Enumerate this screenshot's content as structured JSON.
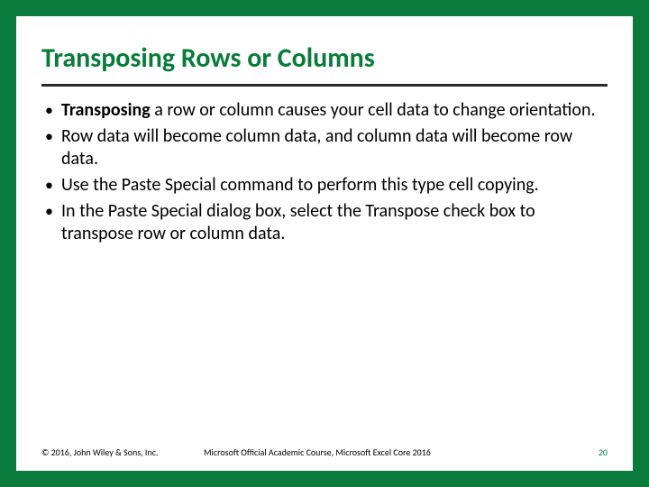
{
  "title": "Transposing Rows or Columns",
  "bullets": [
    {
      "strong": "Transposing",
      "rest": " a row or column causes your cell data to change orientation."
    },
    {
      "strong": "",
      "rest": "Row data will become column data, and column data will become row data."
    },
    {
      "strong": "",
      "rest": "Use the Paste Special command to perform this type cell copying."
    },
    {
      "strong": "",
      "rest": "In the Paste Special dialog box, select the Transpose check box to transpose row or column data."
    }
  ],
  "footer": {
    "copyright": "© 2016, John Wiley & Sons, Inc.",
    "course": "Microsoft Official Academic Course, Microsoft Excel Core 2016",
    "page": "20"
  }
}
